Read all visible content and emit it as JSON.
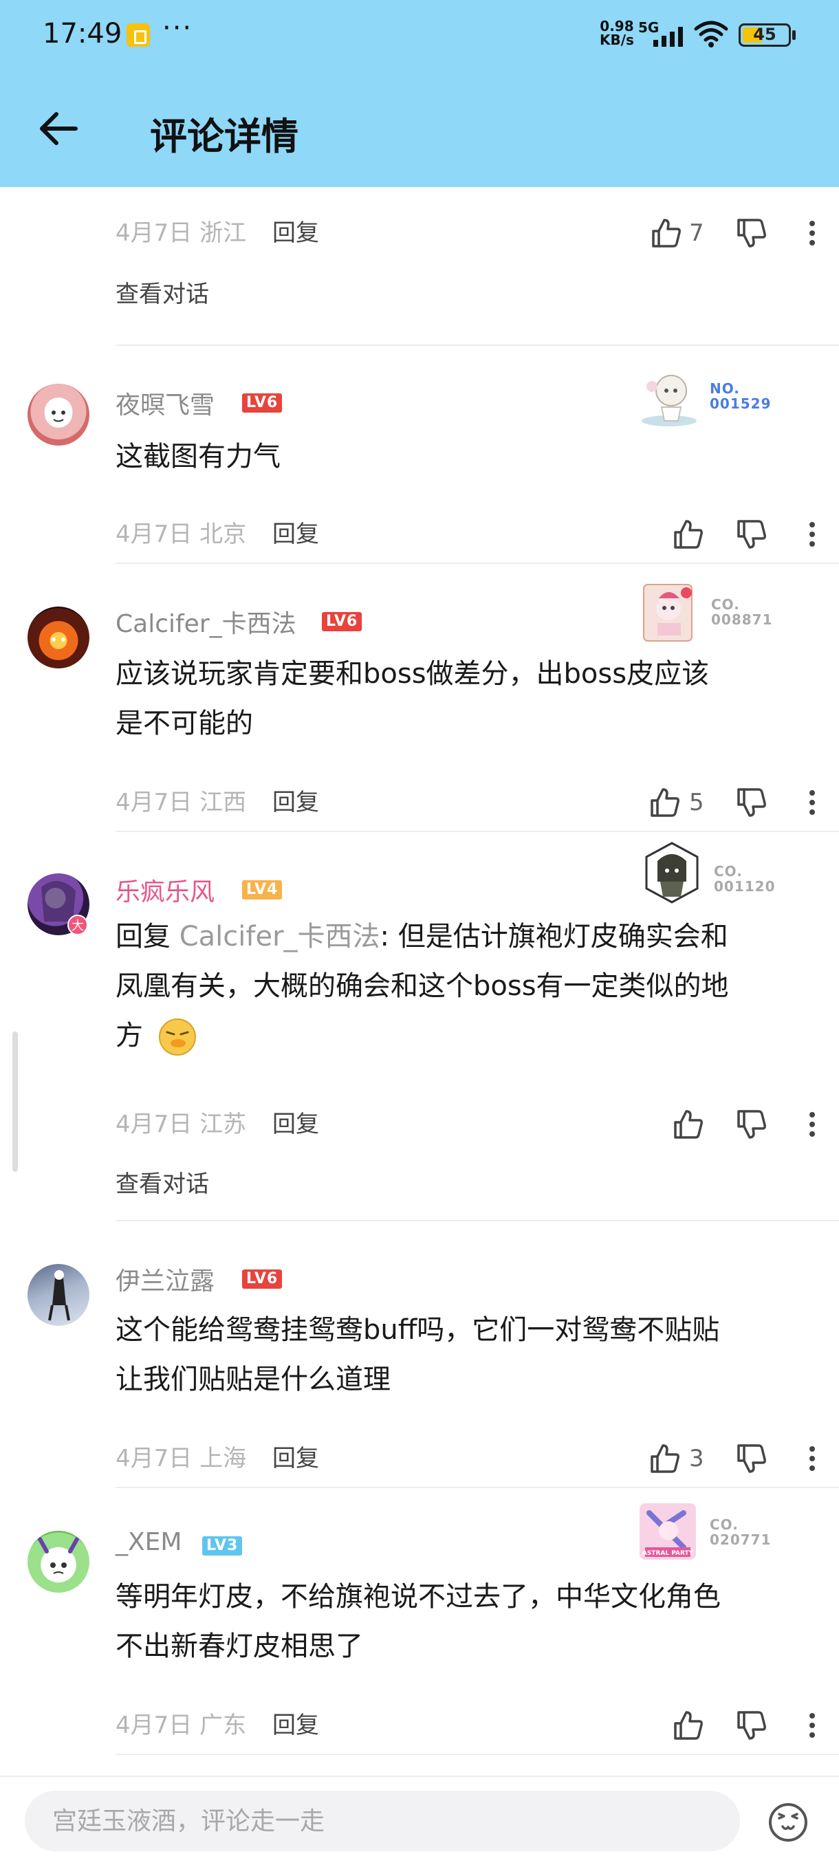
{
  "status_bar": {
    "time": "17:49",
    "more": "···",
    "net_speed_value": "0.98",
    "net_speed_unit": "KB/s",
    "network": "5G",
    "battery": "45",
    "battery_level": 0.45
  },
  "header": {
    "title": "评论详情"
  },
  "comments": [
    {
      "date": "4月7日 浙江",
      "reply_label": "回复",
      "likes": "7",
      "view_conversation": "查看对话"
    },
    {
      "username": "夜暝飞雪",
      "level": "LV6",
      "level_color": "#e8433c",
      "badge_code_line1": "NO.",
      "badge_code_line2": "001529",
      "text": "这截图有力气",
      "date": "4月7日 北京",
      "reply_label": "回复",
      "likes": ""
    },
    {
      "username": "Calcifer_卡西法",
      "level": "LV6",
      "level_color": "#e8433c",
      "badge_code_line1": "CO.",
      "badge_code_line2": "008871",
      "text_line1": "应该说玩家肯定要和boss做差分，出boss皮应该",
      "text_line2": "是不可能的",
      "date": "4月7日 江西",
      "reply_label": "回复",
      "likes": "5"
    },
    {
      "username": "乐疯乐风",
      "level": "LV4",
      "level_color": "#f8b24a",
      "avatar_badge": "大",
      "badge_code_line1": "CO.",
      "badge_code_line2": "001120",
      "reply_prefix": "回复 ",
      "reply_to": "Calcifer_卡西法",
      "text_line1": ": 但是估计旗袍灯皮确实会和",
      "text_line2": "凤凰有关，大概的确会和这个boss有一定类似的地",
      "text_line3": "方",
      "date": "4月7日 江苏",
      "reply_label": "回复",
      "likes": "",
      "view_conversation": "查看对话"
    },
    {
      "username": "伊兰泣露",
      "level": "LV6",
      "level_color": "#e8433c",
      "text_line1": "这个能给鸳鸯挂鸳鸯buff吗，它们一对鸳鸯不贴贴",
      "text_line2": "让我们贴贴是什么道理",
      "date": "4月7日 上海",
      "reply_label": "回复",
      "likes": "3"
    },
    {
      "username": "_XEM",
      "level": "LV3",
      "level_color": "#5ec6ee",
      "badge_code_line1": "CO.",
      "badge_code_line2": "020771",
      "badge_caption": "ASTRAL PARTY",
      "text_line1": "等明年灯皮，不给旗袍说不过去了，中华文化角色",
      "text_line2": "不出新春灯皮相思了",
      "date": "4月7日 广东",
      "reply_label": "回复",
      "likes": ""
    }
  ],
  "bottom_bar": {
    "input_placeholder": "宫廷玉液酒，评论走一走"
  }
}
